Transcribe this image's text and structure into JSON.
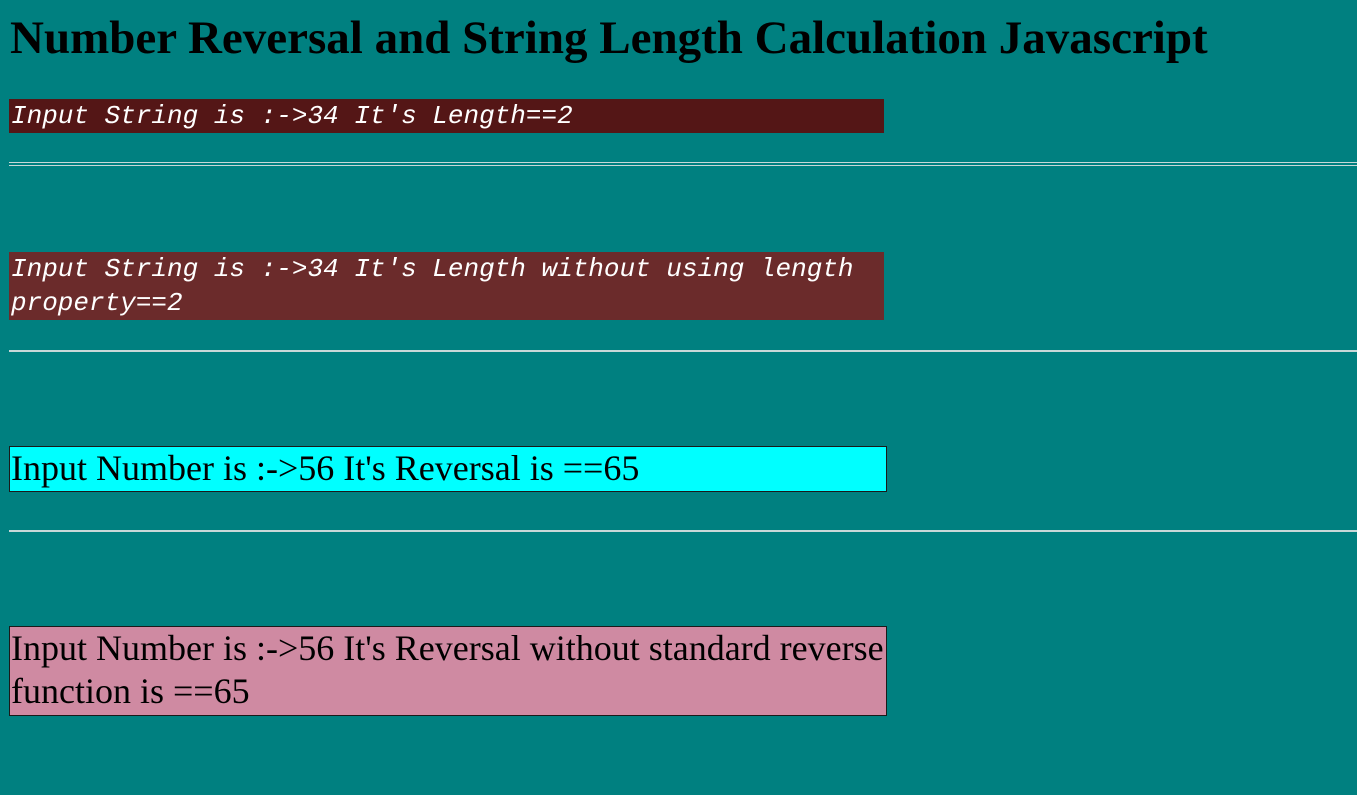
{
  "page": {
    "title": "Number Reversal and String Length Calculation Javascript"
  },
  "results": [
    {
      "text": "Input String is :->34 It's Length==2",
      "background": "#541616",
      "color": "#ffffff"
    },
    {
      "text": "Input String is :->34 It's Length without using length property==2",
      "background": "#6b2b2b",
      "color": "#ffffff"
    },
    {
      "text": "Input Number is :->56 It's Reversal is ==65",
      "background": "#00ffff",
      "color": "#000000"
    },
    {
      "text": "Input Number is :->56 It's Reversal without standard reverse function is ==65",
      "background": "#cf8aa2",
      "color": "#000000"
    }
  ],
  "colors": {
    "page_background": "#008080",
    "divider": "#c8d8d8"
  }
}
